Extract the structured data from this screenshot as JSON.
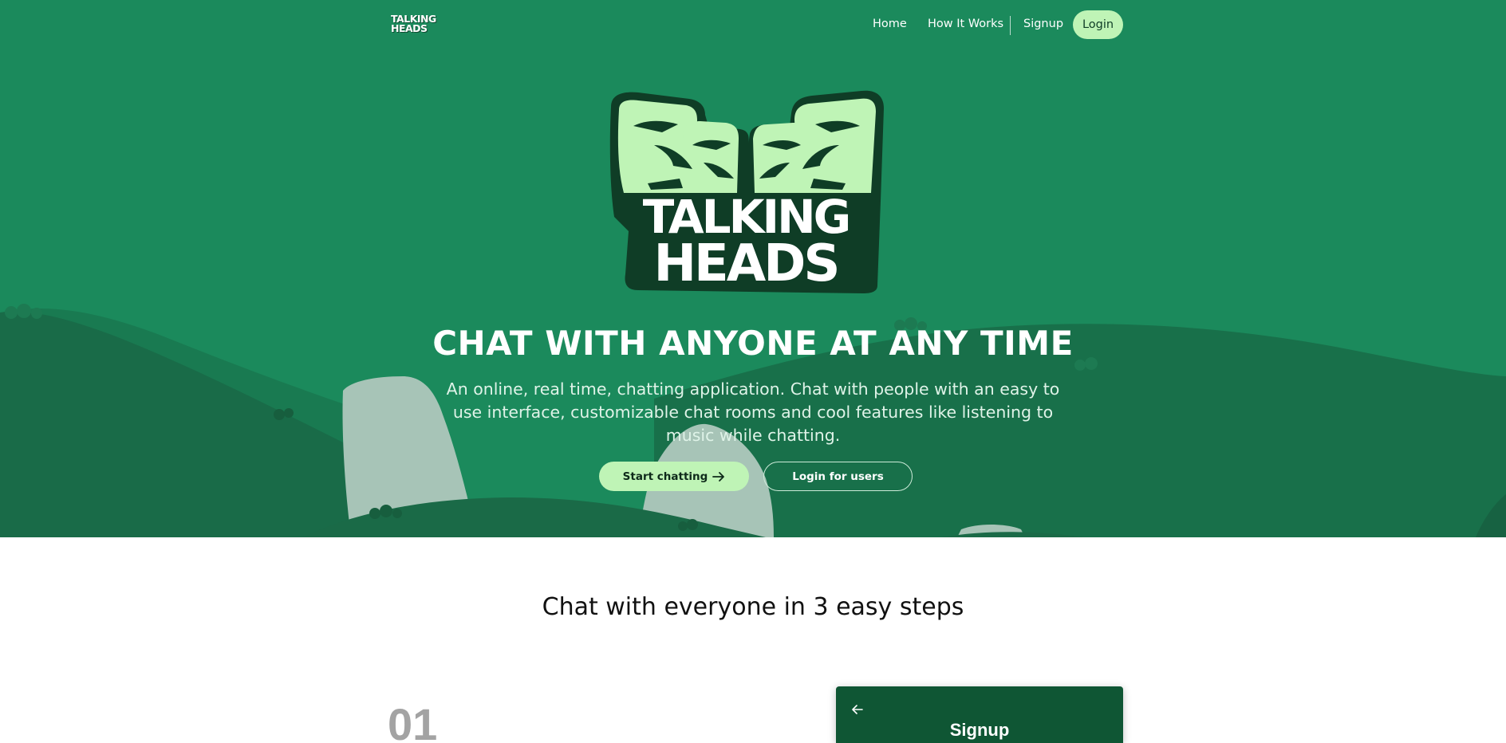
{
  "nav": {
    "brand_line1": "TALKING",
    "brand_line2": "HEADS",
    "home": "Home",
    "how_it_works": "How It Works",
    "signup": "Signup",
    "login": "Login"
  },
  "hero": {
    "logo_line1": "TALKING",
    "logo_line2": "HEADS",
    "title": "CHAT WITH ANYONE AT ANY TIME",
    "subtitle": "An online, real time, chatting application. Chat with people with an easy to use interface, customizable chat rooms and cool features like listening to music while chatting.",
    "start_button": "Start chatting",
    "start_button_icon": "arrow-right-icon",
    "login_button": "Login for users"
  },
  "steps": {
    "title": "Chat with everyone in 3 easy steps",
    "first_number": "01",
    "card": {
      "back_icon": "arrow-left-icon",
      "title": "Signup"
    }
  },
  "colors": {
    "hero_bg": "#1b8a5c",
    "hills_dark": "#196b48",
    "accent": "#bff4b6",
    "card_bg": "#0f5634"
  }
}
